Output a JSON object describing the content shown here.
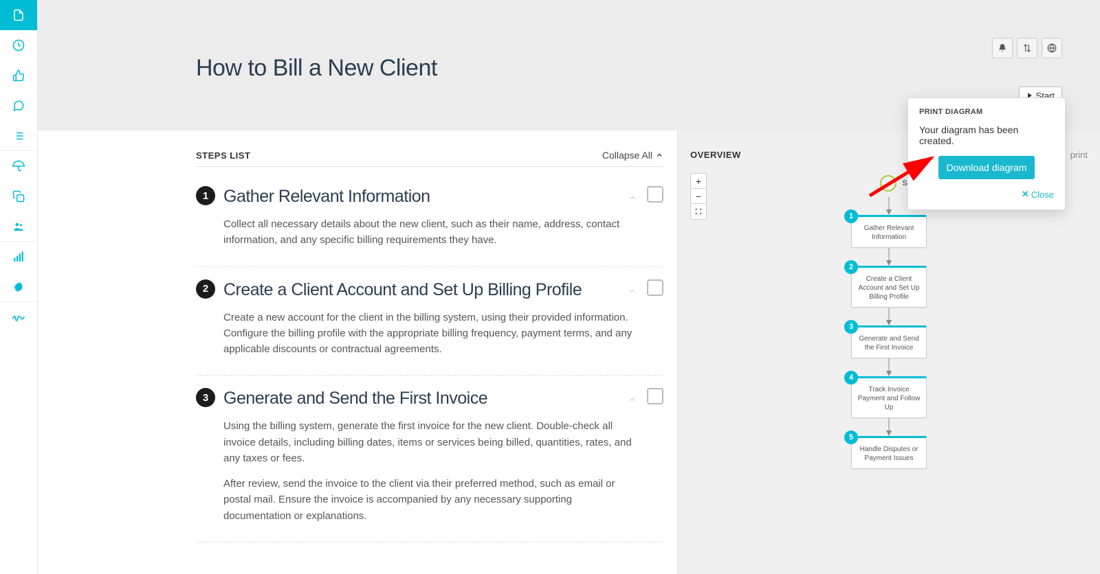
{
  "page": {
    "title": "How to Bill a New Client",
    "start_button": "Start"
  },
  "header_tools": {
    "bell": "bell-icon",
    "sort": "swap-vert-icon",
    "globe": "globe-icon"
  },
  "steps_list": {
    "header": "STEPS LIST",
    "collapse_label": "Collapse All",
    "items": [
      {
        "num": "1",
        "title": "Gather Relevant Information",
        "desc": [
          "Collect all necessary details about the new client, such as their name, address, contact information, and any specific billing requirements they have."
        ]
      },
      {
        "num": "2",
        "title": "Create a Client Account and Set Up Billing Profile",
        "desc": [
          "Create a new account for the client in the billing system, using their provided information. Configure the billing profile with the appropriate billing frequency, payment terms, and any applicable discounts or contractual agreements."
        ]
      },
      {
        "num": "3",
        "title": "Generate and Send the First Invoice",
        "desc": [
          "Using the billing system, generate the first invoice for the new client. Double-check all invoice details, including billing dates, items or services being billed, quantities, rates, and any taxes or fees.",
          "After review, send the invoice to the client via their preferred method, such as email or postal mail. Ensure the invoice is accompanied by any necessary supporting documentation or explanations."
        ]
      }
    ]
  },
  "overview": {
    "title": "OVERVIEW",
    "print_label": "print",
    "start_label": "Start",
    "nodes": [
      {
        "num": "1",
        "label": "Gather Relevant Information"
      },
      {
        "num": "2",
        "label": "Create a Client Account and Set Up Billing Profile"
      },
      {
        "num": "3",
        "label": "Generate and Send the First Invoice"
      },
      {
        "num": "4",
        "label": "Track Invoice Payment and Follow Up"
      },
      {
        "num": "5",
        "label": "Handle Disputes or Payment Issues"
      }
    ]
  },
  "popover": {
    "title": "PRINT DIAGRAM",
    "message": "Your diagram has been created.",
    "button": "Download diagram",
    "close": "Close"
  },
  "sidebar_icons": [
    "file",
    "clock",
    "thumbs-up",
    "chat",
    "list",
    "umbrella",
    "copy",
    "users",
    "stats",
    "gear",
    "signature"
  ]
}
